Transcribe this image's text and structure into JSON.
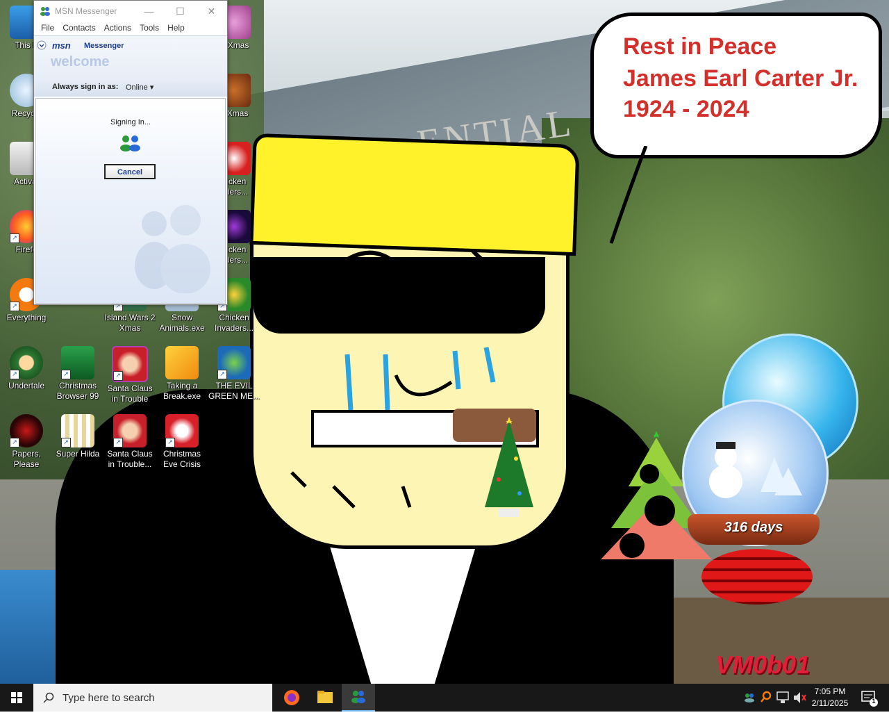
{
  "window": {
    "title": "MSN Messenger",
    "controls": {
      "minimize": "—",
      "maximize": "☐",
      "close": "✕"
    },
    "menu": [
      "File",
      "Contacts",
      "Actions",
      "Tools",
      "Help"
    ],
    "logo_text": "msn",
    "product": "Messenger",
    "welcome": "welcome",
    "sign_in_label": "Always sign in as:",
    "sign_in_status": "Online ▾",
    "signing_in": "Signing In...",
    "cancel_label": "Cancel"
  },
  "desktop_icons": [
    {
      "label": "This P",
      "name": "this-pc-icon"
    },
    {
      "label": "Recycle",
      "name": "recycle-bin-icon"
    },
    {
      "label": "Activat",
      "name": "activate-icon"
    },
    {
      "label": "Firefo",
      "name": "firefox-icon"
    },
    {
      "label": "Everything",
      "name": "everything-icon"
    },
    {
      "label": "Undertale",
      "name": "undertale-icon"
    },
    {
      "label": "Papers, Please",
      "name": "papers-please-icon"
    },
    {
      "label": "Christmas Browser 99",
      "name": "christmas-browser-icon"
    },
    {
      "label": "Super Hilda",
      "name": "super-hilda-icon"
    },
    {
      "label": "Island Wars 2 Xmas",
      "name": "island-wars-icon"
    },
    {
      "label": "Santa Claus in Trouble",
      "name": "santa-claus-icon"
    },
    {
      "label": "Santa Claus in Trouble...",
      "name": "santa-claus-2-icon"
    },
    {
      "label": "Snow Animals.exe",
      "name": "snow-animals-icon"
    },
    {
      "label": "Taking a Break.exe",
      "name": "taking-break-icon"
    },
    {
      "label": "Christmas Eve Crisis",
      "name": "christmas-eve-icon"
    },
    {
      "label": "ly Xmas",
      "name": "xmas-game-icon"
    },
    {
      "label": "o Xmas",
      "name": "xmas-game-2-icon"
    },
    {
      "label": "hicken aders...",
      "name": "chicken-invaders-1-icon"
    },
    {
      "label": "hicken aders...",
      "name": "chicken-invaders-2-icon"
    },
    {
      "label": "Chicken Invaders...",
      "name": "chicken-invaders-3-icon"
    },
    {
      "label": "THE EVIL GREEN ME...",
      "name": "evil-green-icon"
    }
  ],
  "wallpaper": {
    "bubble_lines": [
      "Rest in Peace",
      "James Earl Carter Jr.",
      "1924 - 2024"
    ],
    "sign_text": "ENTIAL",
    "days": "316 days",
    "watermark": "VM0b01"
  },
  "taskbar": {
    "search_placeholder": "Type here to search",
    "time": "7:05 PM",
    "date": "2/11/2025",
    "notification_count": "1"
  }
}
